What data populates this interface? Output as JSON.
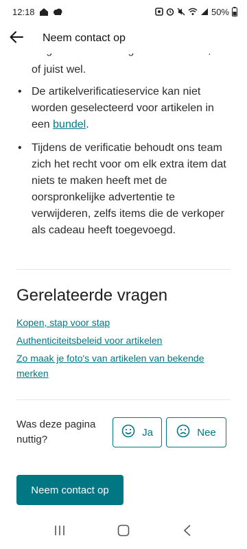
{
  "status": {
    "time": "12:18",
    "battery": "50%"
  },
  "app_bar": {
    "title": "Neem contact op"
  },
  "content": {
    "clipped_line": "langer in aanmerking voor verificatie,",
    "line_after": "of juist wel.",
    "bullets": [
      {
        "before": "De artikelverificatieservice kan niet worden geselecteerd voor artikelen in een ",
        "link": "bundel",
        "after": "."
      },
      {
        "text": "Tijdens de verificatie behoudt ons team zich het recht voor om elk extra item dat niets te maken heeft met de oorspronkelijke advertentie te verwijderen, zelfs items die de verkoper als cadeau heeft toegevoegd."
      }
    ]
  },
  "related": {
    "title": "Gerelateerde vragen",
    "links": [
      "Kopen, stap voor stap",
      "Authenticiteitsbeleid voor artikelen",
      "Zo maak je foto's van artikelen van bekende merken"
    ]
  },
  "feedback": {
    "question": "Was deze pagina nuttig?",
    "yes_label": "Ja",
    "no_label": "Nee"
  },
  "contact_button": {
    "label": "Neem contact op"
  },
  "colors": {
    "accent": "#007782",
    "text": "#2b2b2b",
    "divider": "#e6e6e6"
  },
  "icons": {
    "back": "arrow-left-icon",
    "yes": "smile-icon",
    "no": "frown-icon",
    "nav": [
      "recent-apps-icon",
      "home-icon",
      "back-nav-icon"
    ]
  }
}
